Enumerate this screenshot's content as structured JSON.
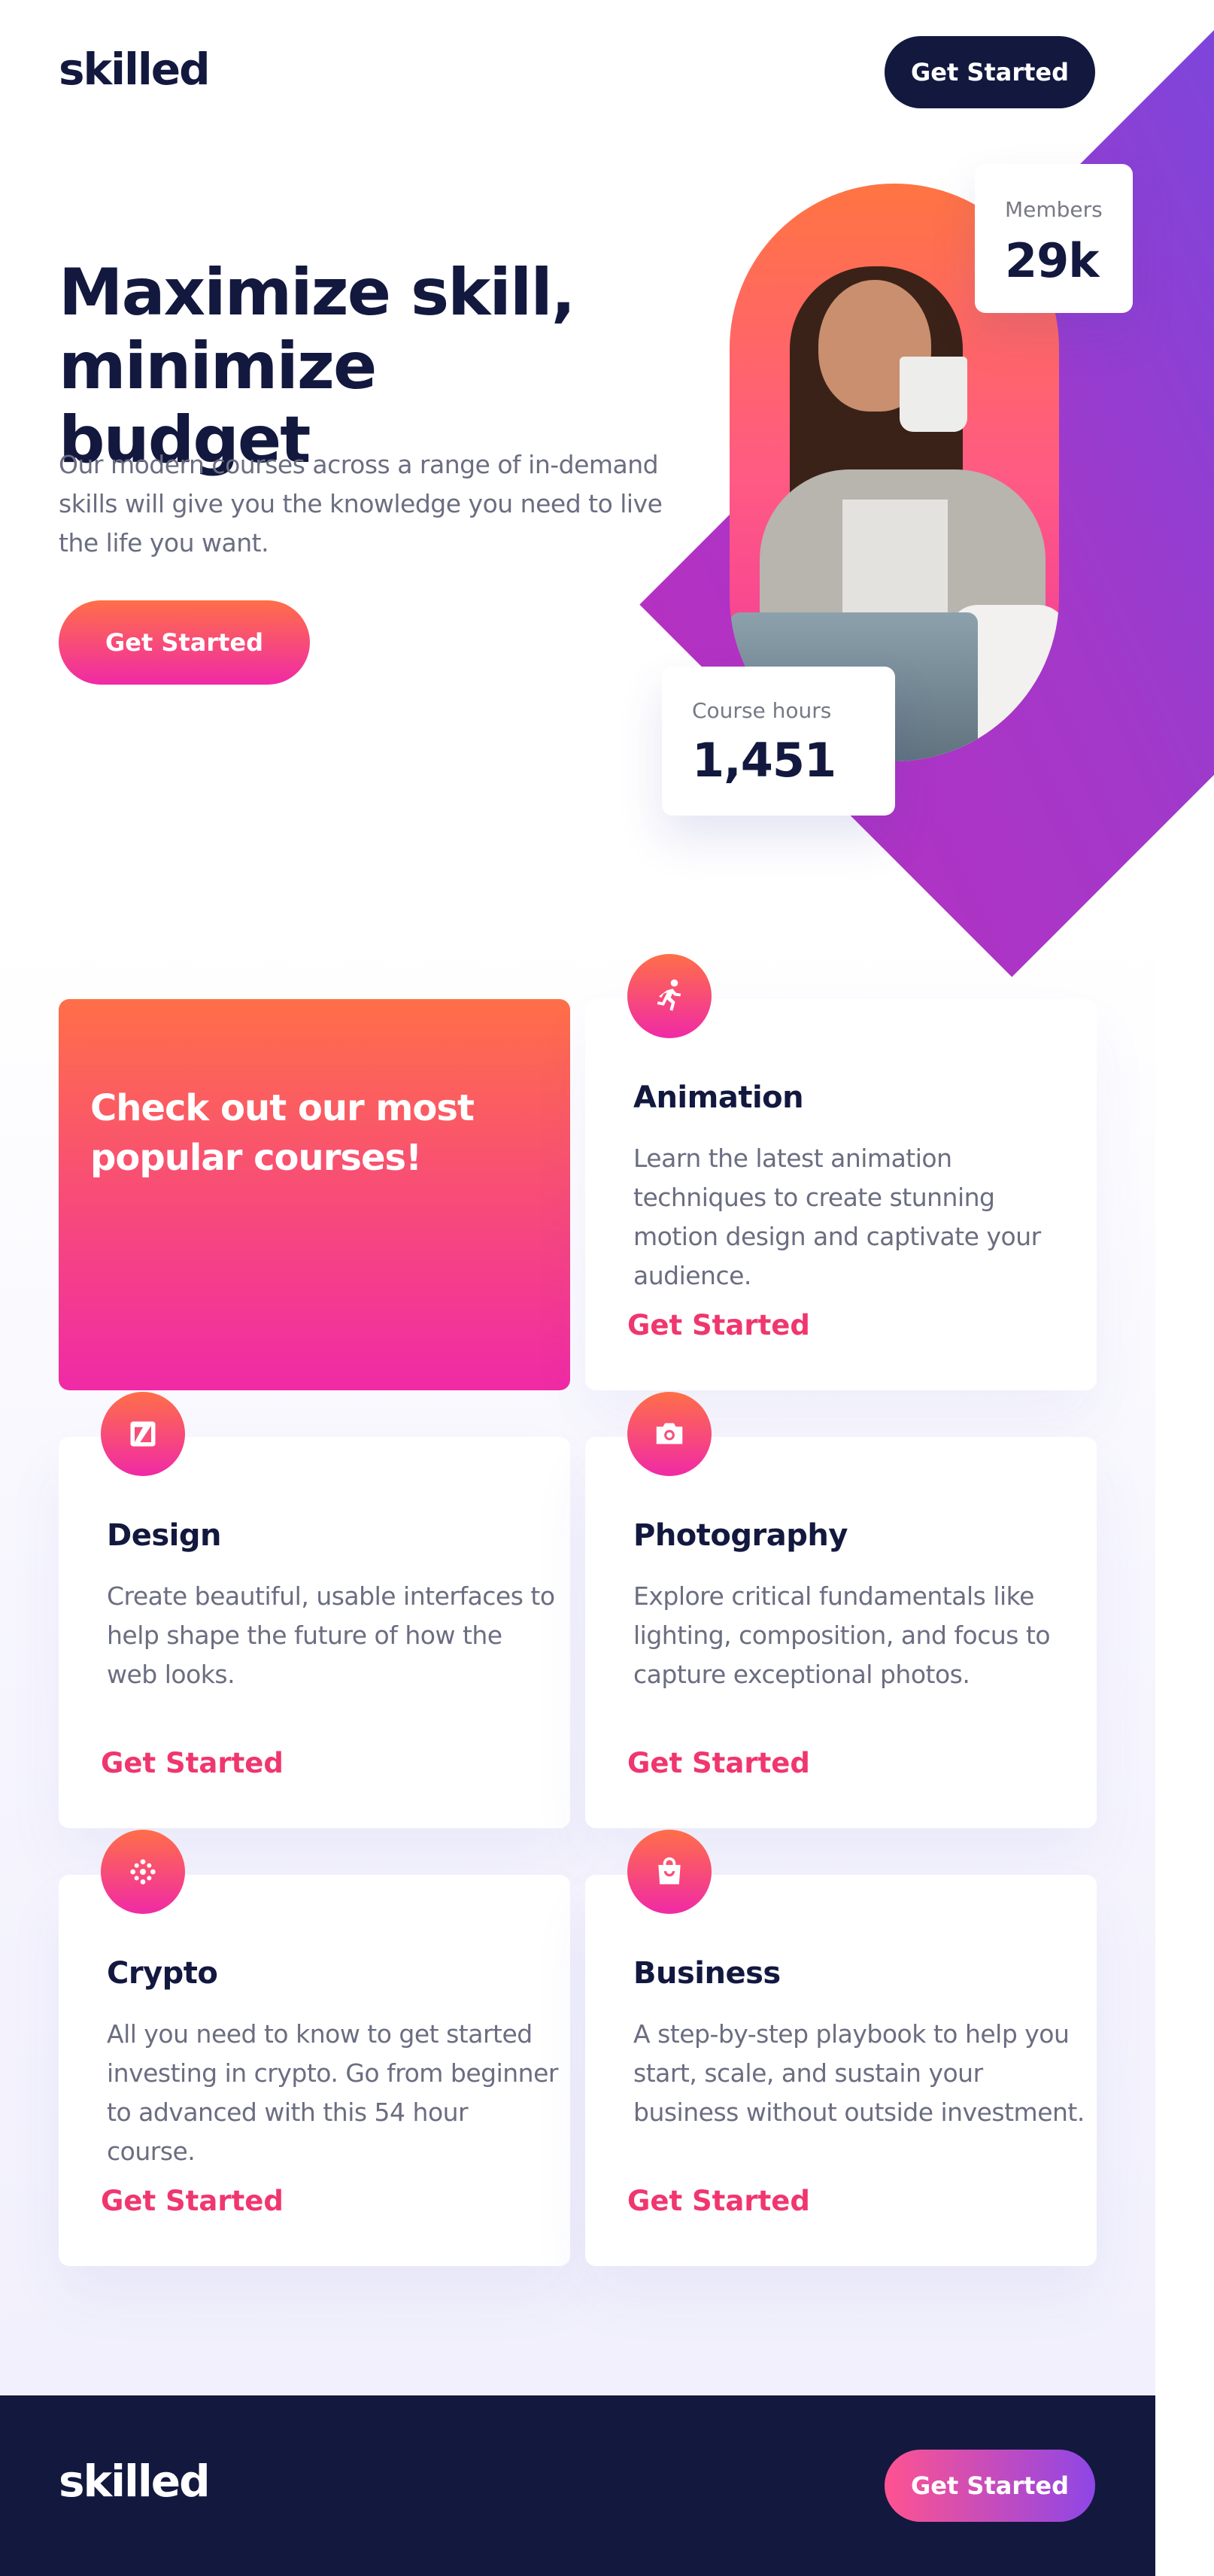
{
  "header": {
    "logo": "skilled",
    "cta_label": "Get Started"
  },
  "hero": {
    "title": "Maximize skill, minimize budget",
    "description": "Our modern courses across a range of in-demand skills will give you the knowledge you need to live the life you want.",
    "cta_label": "Get Started",
    "stats": {
      "members": {
        "label": "Members",
        "value": "29k"
      },
      "course_hours": {
        "label": "Course hours",
        "value": "1,451"
      }
    }
  },
  "courses": {
    "promo_title": "Check out our most popular courses!",
    "items": [
      {
        "title": "Animation",
        "description": "Learn the latest animation techniques to create stunning motion design and captivate your audience.",
        "link": "Get Started",
        "icon": "running-figure-icon"
      },
      {
        "title": "Design",
        "description": "Create beautiful, usable interfaces to help shape the future of how the web looks.",
        "link": "Get Started",
        "icon": "design-icon"
      },
      {
        "title": "Photography",
        "description": "Explore critical fundamentals like lighting, composition, and focus to capture exceptional photos.",
        "link": "Get Started",
        "icon": "camera-icon"
      },
      {
        "title": "Crypto",
        "description": "All you need to know to get started investing in crypto. Go from beginner to advanced with this 54 hour course.",
        "link": "Get Started",
        "icon": "crypto-icon"
      },
      {
        "title": "Business",
        "description": "A step-by-step playbook to help you start, scale, and sustain your business without outside investment.",
        "link": "Get Started",
        "icon": "shopping-bag-icon"
      }
    ]
  },
  "footer": {
    "logo": "skilled",
    "cta_label": "Get Started"
  },
  "colors": {
    "navy": "#13183F",
    "gradient_start": "#FF6F48",
    "gradient_end": "#F02AA6",
    "purple": "#8E46E6",
    "link": "#F0366E",
    "body_text": "#6B6D81"
  }
}
